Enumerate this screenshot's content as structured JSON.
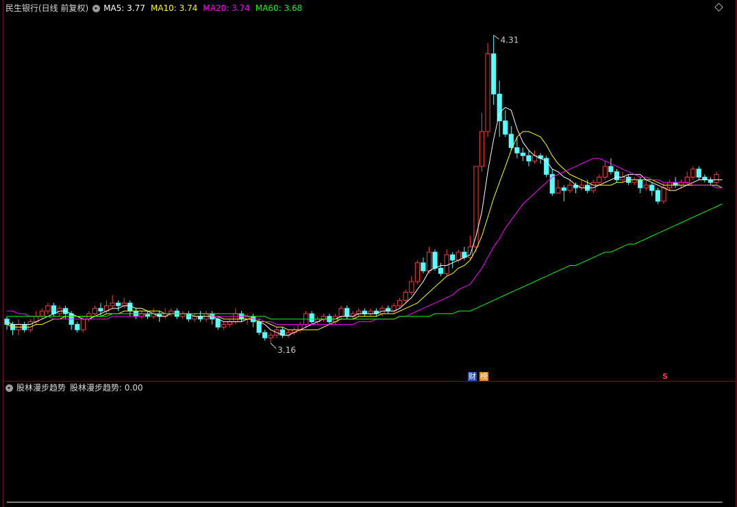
{
  "header": {
    "title": "民生银行(日线 前复权)",
    "ma5_label": "MA5: 3.77",
    "ma10_label": "MA10: 3.74",
    "ma20_label": "MA20: 3.74",
    "ma60_label": "MA60: 3.68"
  },
  "indicator": {
    "name": "股林漫步趋势",
    "value_label": "股林漫步趋势: 0.00"
  },
  "annotations": {
    "high_label": "4.31",
    "low_label": "3.16"
  },
  "markers": {
    "finance": "财",
    "list": "榜",
    "s": "S"
  },
  "colors": {
    "up": "#ff3b3b",
    "down": "#54ffff",
    "ma5": "#ffffff",
    "ma10": "#ffff00",
    "ma20": "#ff00ff",
    "ma60": "#00ff00",
    "indicator": "#ffffff"
  },
  "chart_data": [
    {
      "type": "candlestick",
      "title": "民生银行(日线 前复权)",
      "high": 4.31,
      "low": 3.16,
      "last_ma": {
        "MA5": 3.77,
        "MA10": 3.74,
        "MA20": 3.74,
        "MA60": 3.68
      },
      "ylim": [
        3.06,
        4.39
      ],
      "candles": [
        [
          3.25,
          3.23,
          3.26,
          3.21
        ],
        [
          3.23,
          3.21,
          3.24,
          3.19
        ],
        [
          3.21,
          3.23,
          3.25,
          3.19
        ],
        [
          3.23,
          3.21,
          3.24,
          3.2
        ],
        [
          3.21,
          3.24,
          3.25,
          3.2
        ],
        [
          3.24,
          3.26,
          3.28,
          3.23
        ],
        [
          3.26,
          3.28,
          3.29,
          3.25
        ],
        [
          3.28,
          3.3,
          3.31,
          3.27
        ],
        [
          3.3,
          3.27,
          3.31,
          3.26
        ],
        [
          3.27,
          3.29,
          3.3,
          3.26
        ],
        [
          3.29,
          3.27,
          3.3,
          3.25
        ],
        [
          3.27,
          3.23,
          3.28,
          3.21
        ],
        [
          3.23,
          3.21,
          3.24,
          3.2
        ],
        [
          3.21,
          3.25,
          3.26,
          3.2
        ],
        [
          3.25,
          3.27,
          3.28,
          3.24
        ],
        [
          3.27,
          3.29,
          3.3,
          3.26
        ],
        [
          3.29,
          3.28,
          3.31,
          3.26
        ],
        [
          3.28,
          3.3,
          3.32,
          3.27
        ],
        [
          3.3,
          3.31,
          3.34,
          3.29
        ],
        [
          3.31,
          3.3,
          3.32,
          3.28
        ],
        [
          3.3,
          3.31,
          3.33,
          3.29
        ],
        [
          3.31,
          3.28,
          3.32,
          3.26
        ],
        [
          3.28,
          3.26,
          3.29,
          3.25
        ],
        [
          3.26,
          3.27,
          3.28,
          3.25
        ],
        [
          3.27,
          3.26,
          3.28,
          3.25
        ],
        [
          3.26,
          3.27,
          3.29,
          3.25
        ],
        [
          3.27,
          3.26,
          3.28,
          3.24
        ],
        [
          3.26,
          3.27,
          3.29,
          3.25
        ],
        [
          3.27,
          3.28,
          3.29,
          3.26
        ],
        [
          3.28,
          3.26,
          3.29,
          3.25
        ],
        [
          3.26,
          3.27,
          3.28,
          3.25
        ],
        [
          3.27,
          3.25,
          3.28,
          3.24
        ],
        [
          3.25,
          3.26,
          3.27,
          3.24
        ],
        [
          3.26,
          3.25,
          3.28,
          3.24
        ],
        [
          3.25,
          3.27,
          3.28,
          3.24
        ],
        [
          3.27,
          3.25,
          3.28,
          3.23
        ],
        [
          3.25,
          3.22,
          3.26,
          3.21
        ],
        [
          3.22,
          3.23,
          3.24,
          3.21
        ],
        [
          3.23,
          3.24,
          3.25,
          3.22
        ],
        [
          3.24,
          3.27,
          3.29,
          3.23
        ],
        [
          3.27,
          3.25,
          3.28,
          3.24
        ],
        [
          3.25,
          3.26,
          3.27,
          3.23
        ],
        [
          3.26,
          3.24,
          3.27,
          3.22
        ],
        [
          3.24,
          3.2,
          3.25,
          3.19
        ],
        [
          3.2,
          3.18,
          3.21,
          3.17
        ],
        [
          3.18,
          3.19,
          3.2,
          3.16
        ],
        [
          3.19,
          3.21,
          3.22,
          3.18
        ],
        [
          3.21,
          3.19,
          3.22,
          3.18
        ],
        [
          3.19,
          3.2,
          3.21,
          3.18
        ],
        [
          3.2,
          3.21,
          3.22,
          3.19
        ],
        [
          3.21,
          3.23,
          3.24,
          3.2
        ],
        [
          3.23,
          3.27,
          3.28,
          3.22
        ],
        [
          3.27,
          3.24,
          3.28,
          3.23
        ],
        [
          3.24,
          3.25,
          3.26,
          3.23
        ],
        [
          3.25,
          3.26,
          3.27,
          3.24
        ],
        [
          3.26,
          3.24,
          3.27,
          3.23
        ],
        [
          3.24,
          3.26,
          3.27,
          3.23
        ],
        [
          3.26,
          3.29,
          3.3,
          3.25
        ],
        [
          3.29,
          3.26,
          3.3,
          3.25
        ],
        [
          3.26,
          3.27,
          3.28,
          3.25
        ],
        [
          3.27,
          3.28,
          3.29,
          3.26
        ],
        [
          3.28,
          3.27,
          3.29,
          3.26
        ],
        [
          3.27,
          3.28,
          3.29,
          3.26
        ],
        [
          3.28,
          3.27,
          3.29,
          3.26
        ],
        [
          3.27,
          3.29,
          3.3,
          3.26
        ],
        [
          3.29,
          3.28,
          3.3,
          3.27
        ],
        [
          3.28,
          3.3,
          3.31,
          3.27
        ],
        [
          3.3,
          3.32,
          3.33,
          3.29
        ],
        [
          3.32,
          3.35,
          3.36,
          3.31
        ],
        [
          3.35,
          3.39,
          3.41,
          3.34
        ],
        [
          3.39,
          3.46,
          3.47,
          3.38
        ],
        [
          3.46,
          3.43,
          3.48,
          3.42
        ],
        [
          3.43,
          3.5,
          3.52,
          3.42
        ],
        [
          3.5,
          3.44,
          3.51,
          3.43
        ],
        [
          3.44,
          3.42,
          3.46,
          3.41
        ],
        [
          3.42,
          3.49,
          3.51,
          3.41
        ],
        [
          3.49,
          3.47,
          3.5,
          3.44
        ],
        [
          3.47,
          3.5,
          3.51,
          3.46
        ],
        [
          3.5,
          3.48,
          3.52,
          3.47
        ],
        [
          3.48,
          3.52,
          3.56,
          3.47
        ],
        [
          3.52,
          3.82,
          3.82,
          3.5
        ],
        [
          3.82,
          3.95,
          4.02,
          3.8
        ],
        [
          3.95,
          4.24,
          4.28,
          3.93
        ],
        [
          4.24,
          4.09,
          4.31,
          4.05
        ],
        [
          4.09,
          3.99,
          4.14,
          3.93
        ],
        [
          3.99,
          3.94,
          4.03,
          3.93
        ],
        [
          3.94,
          3.89,
          3.97,
          3.88
        ],
        [
          3.89,
          3.87,
          3.93,
          3.85
        ],
        [
          3.87,
          3.86,
          3.89,
          3.84
        ],
        [
          3.86,
          3.84,
          3.88,
          3.82
        ],
        [
          3.84,
          3.86,
          3.88,
          3.83
        ],
        [
          3.86,
          3.85,
          3.87,
          3.83
        ],
        [
          3.85,
          3.79,
          3.86,
          3.78
        ],
        [
          3.79,
          3.72,
          3.81,
          3.71
        ],
        [
          3.72,
          3.74,
          3.77,
          3.72
        ],
        [
          3.74,
          3.73,
          3.75,
          3.69
        ],
        [
          3.73,
          3.75,
          3.77,
          3.72
        ],
        [
          3.75,
          3.74,
          3.76,
          3.72
        ],
        [
          3.74,
          3.75,
          3.77,
          3.73
        ],
        [
          3.75,
          3.73,
          3.77,
          3.72
        ],
        [
          3.73,
          3.76,
          3.77,
          3.72
        ],
        [
          3.76,
          3.78,
          3.79,
          3.75
        ],
        [
          3.78,
          3.82,
          3.84,
          3.77
        ],
        [
          3.82,
          3.8,
          3.85,
          3.79
        ],
        [
          3.8,
          3.77,
          3.81,
          3.76
        ],
        [
          3.77,
          3.78,
          3.8,
          3.76
        ],
        [
          3.78,
          3.76,
          3.79,
          3.75
        ],
        [
          3.76,
          3.77,
          3.78,
          3.75
        ],
        [
          3.77,
          3.74,
          3.78,
          3.72
        ],
        [
          3.74,
          3.75,
          3.77,
          3.73
        ],
        [
          3.75,
          3.73,
          3.76,
          3.71
        ],
        [
          3.73,
          3.69,
          3.74,
          3.68
        ],
        [
          3.69,
          3.74,
          3.76,
          3.68
        ],
        [
          3.74,
          3.76,
          3.77,
          3.73
        ],
        [
          3.76,
          3.75,
          3.78,
          3.74
        ],
        [
          3.75,
          3.76,
          3.77,
          3.74
        ],
        [
          3.76,
          3.78,
          3.8,
          3.75
        ],
        [
          3.78,
          3.81,
          3.82,
          3.77
        ],
        [
          3.81,
          3.78,
          3.82,
          3.77
        ],
        [
          3.78,
          3.77,
          3.79,
          3.76
        ],
        [
          3.77,
          3.76,
          3.78,
          3.75
        ],
        [
          3.76,
          3.79,
          3.8,
          3.75
        ]
      ],
      "ma5": [
        3.24,
        3.23,
        3.23,
        3.23,
        3.23,
        3.24,
        3.25,
        3.26,
        3.27,
        3.28,
        3.28,
        3.27,
        3.26,
        3.25,
        3.25,
        3.26,
        3.27,
        3.28,
        3.29,
        3.29,
        3.3,
        3.3,
        3.29,
        3.29,
        3.28,
        3.27,
        3.26,
        3.26,
        3.27,
        3.27,
        3.27,
        3.27,
        3.26,
        3.26,
        3.26,
        3.26,
        3.25,
        3.24,
        3.24,
        3.24,
        3.24,
        3.25,
        3.25,
        3.24,
        3.23,
        3.21,
        3.2,
        3.19,
        3.19,
        3.2,
        3.21,
        3.22,
        3.23,
        3.24,
        3.25,
        3.25,
        3.25,
        3.26,
        3.26,
        3.26,
        3.27,
        3.27,
        3.27,
        3.27,
        3.28,
        3.28,
        3.28,
        3.29,
        3.31,
        3.33,
        3.36,
        3.39,
        3.43,
        3.44,
        3.45,
        3.45,
        3.46,
        3.47,
        3.48,
        3.49,
        3.56,
        3.65,
        3.8,
        3.92,
        4.02,
        4.04,
        4.03,
        3.96,
        3.91,
        3.88,
        3.86,
        3.85,
        3.84,
        3.81,
        3.8,
        3.78,
        3.77,
        3.75,
        3.74,
        3.74,
        3.74,
        3.75,
        3.76,
        3.77,
        3.78,
        3.78,
        3.79,
        3.79,
        3.79,
        3.77,
        3.76,
        3.75,
        3.74,
        3.73,
        3.73,
        3.74,
        3.75,
        3.76,
        3.77,
        3.77,
        3.77,
        3.77,
        3.77
      ],
      "ma10": [
        3.23,
        3.22,
        3.22,
        3.22,
        3.22,
        3.23,
        3.23,
        3.24,
        3.25,
        3.25,
        3.26,
        3.26,
        3.26,
        3.26,
        3.26,
        3.26,
        3.26,
        3.27,
        3.27,
        3.27,
        3.28,
        3.28,
        3.28,
        3.28,
        3.28,
        3.28,
        3.28,
        3.27,
        3.27,
        3.27,
        3.27,
        3.27,
        3.27,
        3.27,
        3.27,
        3.26,
        3.26,
        3.25,
        3.25,
        3.25,
        3.25,
        3.25,
        3.25,
        3.24,
        3.24,
        3.23,
        3.22,
        3.22,
        3.21,
        3.21,
        3.21,
        3.21,
        3.21,
        3.21,
        3.22,
        3.23,
        3.24,
        3.25,
        3.25,
        3.25,
        3.26,
        3.26,
        3.26,
        3.26,
        3.27,
        3.27,
        3.27,
        3.28,
        3.29,
        3.3,
        3.31,
        3.33,
        3.35,
        3.37,
        3.39,
        3.41,
        3.42,
        3.44,
        3.45,
        3.47,
        3.51,
        3.56,
        3.63,
        3.7,
        3.76,
        3.82,
        3.88,
        3.93,
        3.95,
        3.95,
        3.94,
        3.93,
        3.9,
        3.86,
        3.83,
        3.81,
        3.79,
        3.78,
        3.77,
        3.76,
        3.75,
        3.75,
        3.75,
        3.75,
        3.76,
        3.76,
        3.77,
        3.77,
        3.77,
        3.77,
        3.77,
        3.76,
        3.75,
        3.75,
        3.75,
        3.75,
        3.75,
        3.75,
        3.75,
        3.75,
        3.75,
        3.75,
        3.74
      ],
      "ma20": [
        3.28,
        3.28,
        3.27,
        3.27,
        3.26,
        3.26,
        3.26,
        3.26,
        3.25,
        3.25,
        3.25,
        3.25,
        3.25,
        3.25,
        3.25,
        3.25,
        3.25,
        3.25,
        3.26,
        3.26,
        3.26,
        3.26,
        3.26,
        3.26,
        3.27,
        3.27,
        3.27,
        3.27,
        3.27,
        3.27,
        3.27,
        3.27,
        3.27,
        3.27,
        3.27,
        3.26,
        3.26,
        3.26,
        3.26,
        3.26,
        3.26,
        3.26,
        3.25,
        3.25,
        3.24,
        3.24,
        3.23,
        3.23,
        3.23,
        3.23,
        3.23,
        3.23,
        3.23,
        3.23,
        3.23,
        3.23,
        3.23,
        3.23,
        3.23,
        3.23,
        3.24,
        3.24,
        3.24,
        3.25,
        3.25,
        3.25,
        3.25,
        3.26,
        3.26,
        3.27,
        3.28,
        3.29,
        3.3,
        3.31,
        3.32,
        3.33,
        3.34,
        3.36,
        3.37,
        3.38,
        3.41,
        3.44,
        3.48,
        3.52,
        3.55,
        3.59,
        3.62,
        3.65,
        3.68,
        3.7,
        3.72,
        3.74,
        3.76,
        3.78,
        3.79,
        3.8,
        3.81,
        3.82,
        3.83,
        3.84,
        3.85,
        3.85,
        3.84,
        3.83,
        3.82,
        3.81,
        3.8,
        3.79,
        3.78,
        3.78,
        3.77,
        3.77,
        3.76,
        3.76,
        3.76,
        3.76,
        3.76,
        3.75,
        3.75,
        3.75,
        3.75,
        3.74,
        3.74
      ],
      "ma60": [
        3.26,
        3.26,
        3.26,
        3.26,
        3.26,
        3.26,
        3.26,
        3.26,
        3.26,
        3.26,
        3.26,
        3.26,
        3.26,
        3.26,
        3.26,
        3.26,
        3.26,
        3.26,
        3.27,
        3.27,
        3.27,
        3.27,
        3.27,
        3.27,
        3.27,
        3.27,
        3.27,
        3.27,
        3.27,
        3.27,
        3.27,
        3.27,
        3.27,
        3.27,
        3.27,
        3.27,
        3.27,
        3.27,
        3.27,
        3.27,
        3.27,
        3.26,
        3.26,
        3.26,
        3.26,
        3.25,
        3.25,
        3.25,
        3.25,
        3.25,
        3.25,
        3.25,
        3.25,
        3.25,
        3.25,
        3.25,
        3.25,
        3.25,
        3.25,
        3.25,
        3.25,
        3.25,
        3.25,
        3.25,
        3.25,
        3.25,
        3.25,
        3.26,
        3.26,
        3.26,
        3.26,
        3.26,
        3.26,
        3.27,
        3.27,
        3.27,
        3.27,
        3.28,
        3.28,
        3.28,
        3.29,
        3.3,
        3.31,
        3.32,
        3.33,
        3.34,
        3.35,
        3.36,
        3.37,
        3.38,
        3.39,
        3.4,
        3.41,
        3.42,
        3.43,
        3.44,
        3.45,
        3.45,
        3.46,
        3.47,
        3.48,
        3.49,
        3.5,
        3.5,
        3.51,
        3.52,
        3.53,
        3.53,
        3.54,
        3.55,
        3.56,
        3.57,
        3.58,
        3.59,
        3.6,
        3.61,
        3.62,
        3.63,
        3.64,
        3.65,
        3.66,
        3.67,
        3.68
      ]
    },
    {
      "type": "line",
      "title": "股林漫步趋势",
      "ylim": [
        0,
        1
      ],
      "values": [
        0,
        0,
        0,
        0,
        0,
        0,
        0,
        0,
        0,
        0,
        0,
        0,
        0,
        0,
        0,
        0,
        0,
        0,
        0,
        0,
        0,
        0,
        0,
        0,
        0,
        0,
        0,
        0,
        0,
        0,
        0,
        0,
        0,
        0,
        0,
        0,
        0,
        0,
        0,
        0,
        0,
        0,
        0,
        0,
        0,
        0,
        0,
        0,
        0,
        0,
        0,
        0,
        0,
        0,
        0,
        0,
        0,
        0,
        0,
        0,
        0,
        0,
        0,
        0,
        0,
        0,
        0,
        0,
        0,
        0,
        0,
        0,
        0,
        0,
        0,
        0,
        0,
        0,
        0,
        0,
        0,
        0,
        0,
        0,
        0,
        0,
        0,
        0,
        0,
        0,
        0,
        0,
        0,
        0,
        0,
        0,
        0,
        0,
        0,
        0,
        0,
        0,
        0,
        0,
        0,
        0,
        0,
        0,
        0,
        0,
        0,
        0,
        0,
        0,
        0,
        0,
        0,
        0,
        0,
        0,
        0,
        0,
        0
      ]
    }
  ]
}
